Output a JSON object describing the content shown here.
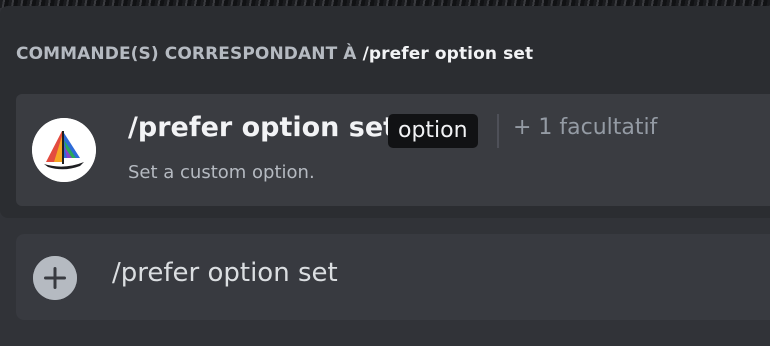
{
  "autocomplete": {
    "header_prefix": "COMMANDE(S) CORRESPONDANT À",
    "header_query": "/prefer option set",
    "commands": [
      {
        "name": "/prefer option set",
        "required_option": "option",
        "optional_count_label": "+ 1 facultatif",
        "description": "Set a custom option.",
        "bot_icon": "midjourney-sailboat-icon"
      }
    ]
  },
  "message_input": {
    "value": "/prefer option set",
    "attach_icon": "plus-circle-icon"
  },
  "colors": {
    "background": "#313338",
    "popup": "#2b2d31",
    "selected_row": "#3a3c41",
    "input_bar": "#383a40",
    "option_pill": "#111214",
    "header_text": "#b5bac1",
    "primary_text": "#f2f3f5",
    "muted_text": "#949ba4"
  }
}
